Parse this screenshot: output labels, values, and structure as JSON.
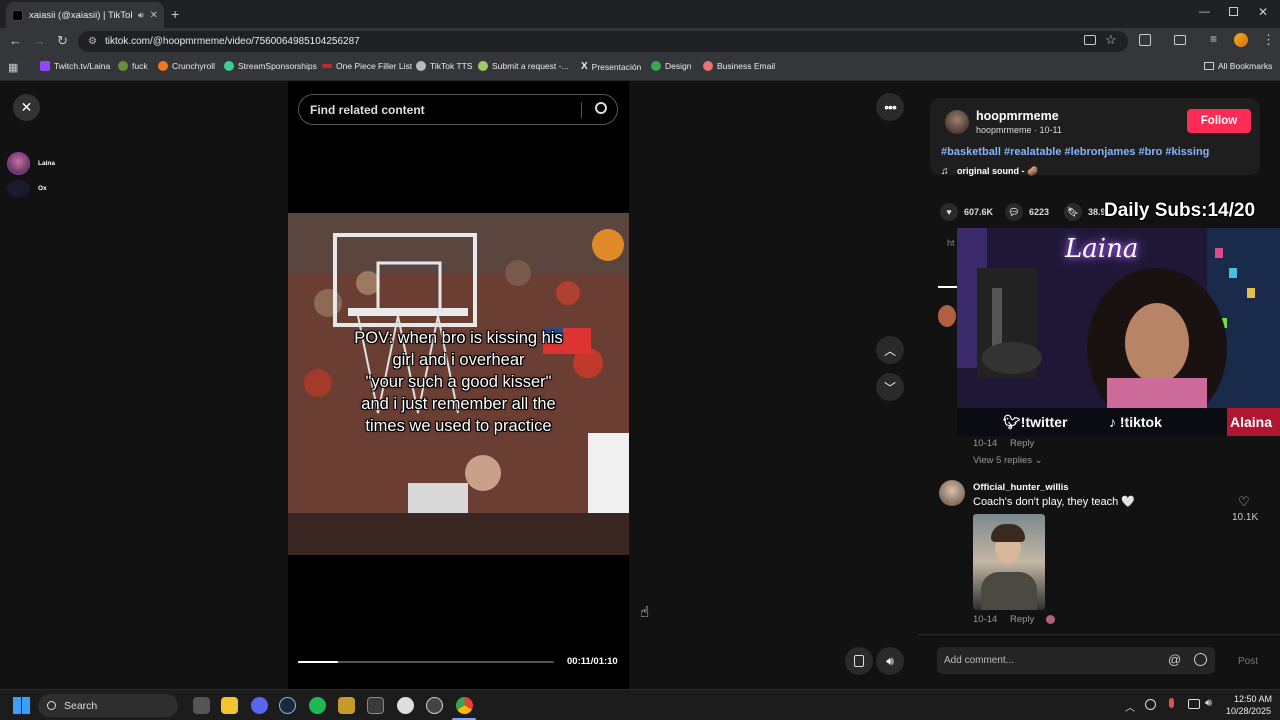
{
  "browser": {
    "tab_title": "xaiasii (@xaiasii) | TikTok",
    "url": "tiktok.com/@hoopmrmeme/video/7560064985104256287",
    "bookmarks": [
      "Twitch.tv/Laina",
      "fuck",
      "Crunchyroll",
      "StreamSponsorships",
      "One Piece Filler List",
      "TikTok TTS",
      "Submit a request -...",
      "Presentación",
      "Design",
      "Business Email"
    ],
    "all_bookmarks": "All Bookmarks"
  },
  "left_rail": {
    "items": [
      {
        "name": "Laina"
      },
      {
        "name": "Ox"
      }
    ]
  },
  "player": {
    "search_placeholder": "Find related content",
    "caption_lines": [
      "POV: when bro is kissing his",
      "girl and i overhear",
      "\"your such a good kisser\"",
      "and i just remember all the",
      "times we used to practice"
    ],
    "time": "00:11/01:10",
    "progress": 0.157
  },
  "author": {
    "name": "hoopmrmeme",
    "handle_date": "hoopmrmeme · 10-11",
    "follow_label": "Follow",
    "hashtags": "#basketball #realatable #lebronjames #bro #kissing",
    "sound": "original sound - 🥔"
  },
  "stats": {
    "likes": "607.6K",
    "comments": "6223",
    "saves": "38.9"
  },
  "comments": [
    {
      "date": "10-14",
      "reply": "Reply",
      "view_replies": "View 5 replies"
    },
    {
      "user": "Official_hunter_willis",
      "text": "Coach's don't play, they teach 🤍",
      "likes": "10.1K",
      "date": "10-14",
      "reply": "Reply"
    }
  ],
  "comment_box": {
    "placeholder": "Add comment...",
    "post_label": "Post"
  },
  "stream_overlay": {
    "subs": "Daily Subs:14/20",
    "neon_name": "Laina",
    "twitter": "!twitter",
    "tiktok": "!tiktok",
    "name_tag": "Alaina"
  },
  "taskbar": {
    "search_label": "Search",
    "time": "12:50 AM",
    "date": "10/28/2025"
  }
}
